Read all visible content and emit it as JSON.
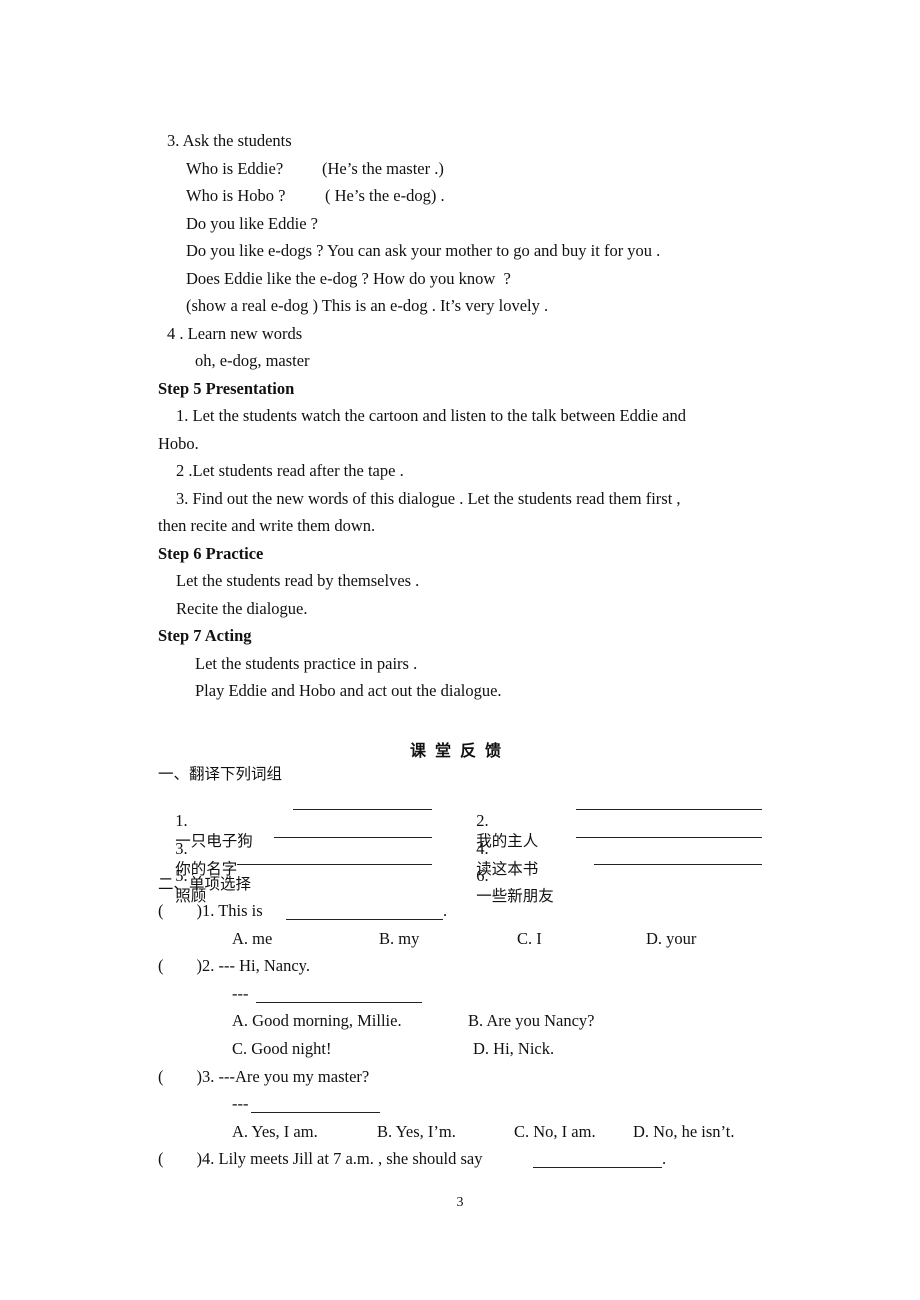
{
  "ask_section": {
    "heading": "3. Ask the students",
    "lines": [
      {
        "q": "Who is Eddie?",
        "a": "(He’s the master .)"
      },
      {
        "q": "Who is Hobo ?",
        "a": "( He’s the e-dog) ."
      },
      {
        "q": "Do you like Eddie ?",
        "a": ""
      },
      {
        "q": "Do you like e-dogs ? You can ask your mother to go and buy it for you .",
        "a": ""
      },
      {
        "q": "Does Eddie like the e-dog ? How do you know  ?",
        "a": ""
      },
      {
        "q": "(show a real e-dog ) This is an e-dog . It’s very lovely .",
        "a": ""
      }
    ]
  },
  "learn_section": {
    "heading": "4 . Learn new words",
    "words": "oh, e-dog, master"
  },
  "step5": {
    "heading": "Step 5 Presentation",
    "item1_line1": "1. Let the students watch the cartoon and listen to the talk between Eddie and",
    "item1_line2": "Hobo.",
    "item2": "2 .Let students read after the tape .",
    "item3_line1": "3. Find out the new words of this dialogue . Let the students read them first ,",
    "item3_line2": "then recite and write them down."
  },
  "step6": {
    "heading": "Step 6 Practice",
    "lines": [
      "Let the students read by themselves .",
      "Recite the dialogue."
    ]
  },
  "step7": {
    "heading": "Step 7 Acting",
    "lines": [
      "Let the students practice in pairs .",
      "Play Eddie and Hobo and act out the dialogue."
    ]
  },
  "feedback": {
    "title": "课堂反馈",
    "part1_heading": "一、翻译下列词组",
    "translate_items": [
      {
        "num": "1.",
        "text": "一只电子狗"
      },
      {
        "num": "2.",
        "text": "我的主人"
      },
      {
        "num": "3.",
        "text": "你的名字"
      },
      {
        "num": "4.",
        "text": "读这本书"
      },
      {
        "num": "5.",
        "text": "照顾"
      },
      {
        "num": "6.",
        "text": "一些新朋友"
      }
    ],
    "part2_heading": "二、单项选择",
    "questions": [
      {
        "paren": "(        )",
        "stem": "1. This is",
        "tail": ".",
        "options": [
          "A. me",
          "B. my",
          "C. I",
          "D. your"
        ]
      },
      {
        "paren": "(        )",
        "stem": "2. --- Hi, Nancy.",
        "reply": "---",
        "options": [
          "A. Good morning, Millie.",
          "B. Are you Nancy?",
          "C. Good night!",
          "D. Hi, Nick."
        ]
      },
      {
        "paren": "(        )",
        "stem": "3. ---Are you my master?",
        "reply": "---",
        "options": [
          "A. Yes, I am.",
          "B. Yes, I’m.",
          "C. No, I am.",
          "D. No, he isn’t."
        ]
      },
      {
        "paren": "(        )",
        "stem": "4. Lily meets Jill at 7 a.m. , she should say",
        "tail": "."
      }
    ]
  },
  "page_number": "3"
}
